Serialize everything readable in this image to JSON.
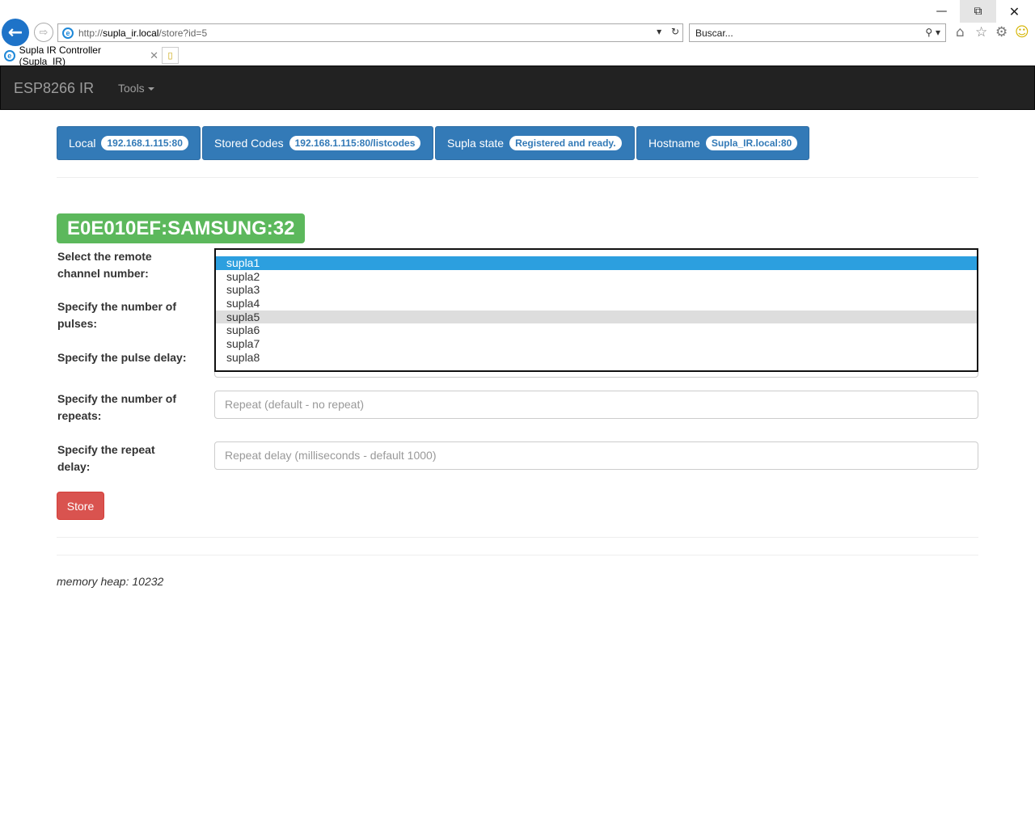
{
  "browser": {
    "back_icon": "←",
    "forward_icon": "⇨",
    "address": {
      "prefix": "http://",
      "host": "supla_ir.local",
      "path": "/store?id=5"
    },
    "search_placeholder": "Buscar...",
    "tab_title": "Supla IR Controller (Supla_IR)",
    "tab_close": "✕",
    "window_controls": {
      "minimize": "—",
      "restore": "⧉",
      "close": "✕"
    },
    "icons": [
      "home-icon",
      "favorites-icon",
      "settings-icon",
      "smiley-icon"
    ]
  },
  "navbar": {
    "brand": "ESP8266 IR",
    "tools": "Tools"
  },
  "info_buttons": [
    {
      "label": "Local",
      "badge": "192.168.1.115:80"
    },
    {
      "label": "Stored Codes",
      "badge": "192.168.1.115:80/listcodes"
    },
    {
      "label": "Supla state",
      "badge": "Registered and ready."
    },
    {
      "label": "Hostname",
      "badge": "Supla_IR.local:80"
    }
  ],
  "code_label": "E0E010EF:SAMSUNG:32",
  "form": {
    "channel_label": "Select the remote channel number:",
    "pulses_label": "Specify the number of pulses:",
    "pulse_delay_label": "Specify the pulse delay:",
    "repeats_label": "Specify the number of repeats:",
    "repeats_placeholder": "Repeat (default - no repeat)",
    "repeat_delay_label": "Specify the repeat delay:",
    "repeat_delay_placeholder": "Repeat delay (milliseconds - default 1000)",
    "channel_options": [
      "supla1",
      "supla2",
      "supla3",
      "supla4",
      "supla5",
      "supla6",
      "supla7",
      "supla8"
    ],
    "selected_option": "supla1",
    "hovered_option": "supla5"
  },
  "store_button": "Store",
  "footer": {
    "memory_heap": "memory heap: 10232"
  }
}
